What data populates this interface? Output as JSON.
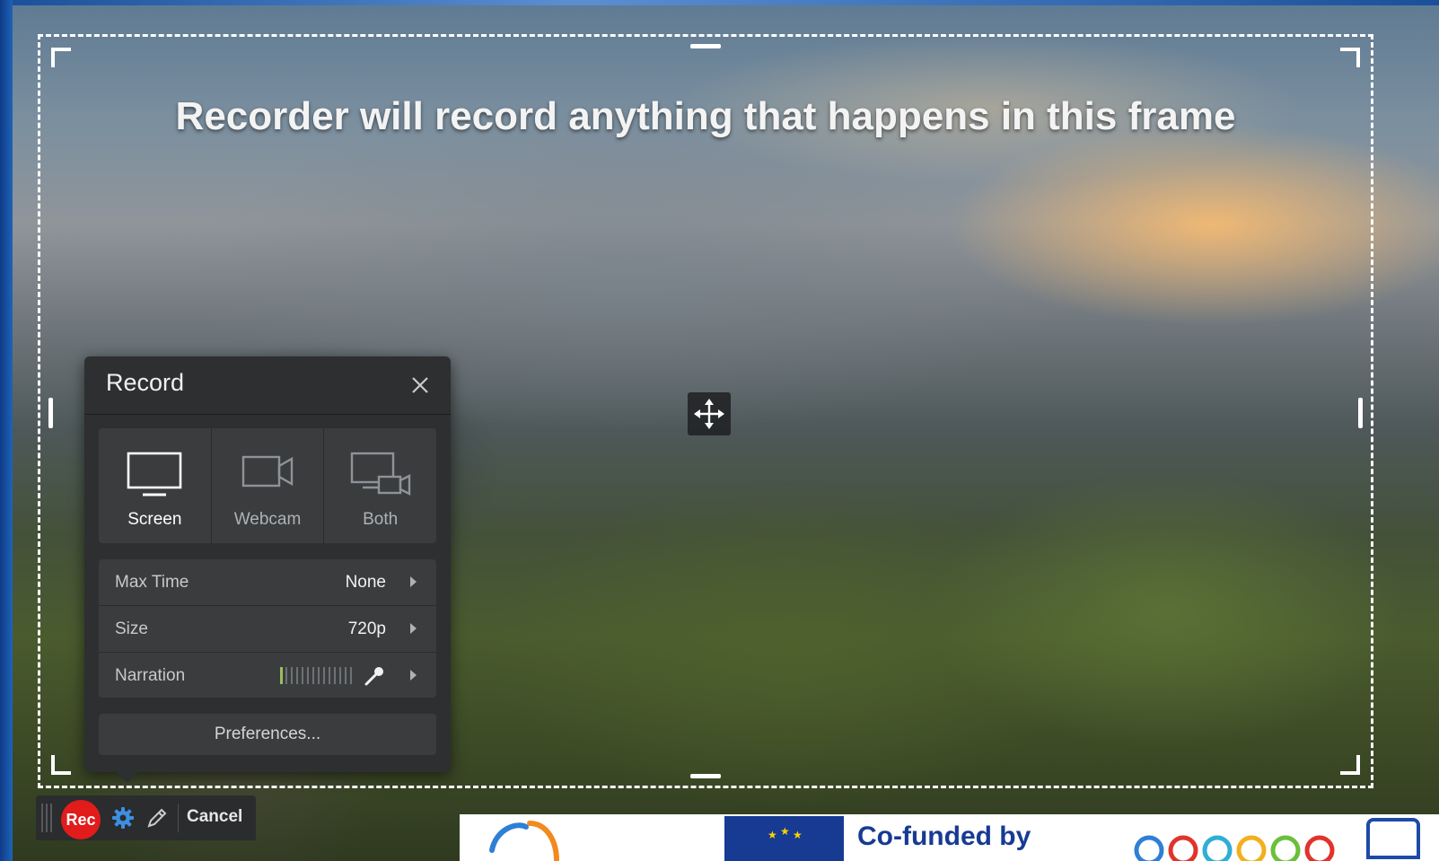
{
  "capture_frame": {
    "title": "Recorder will record anything that happens in this frame"
  },
  "record_panel": {
    "title": "Record",
    "modes": [
      {
        "label": "Screen",
        "icon": "monitor-icon",
        "selected": true
      },
      {
        "label": "Webcam",
        "icon": "webcam-icon",
        "selected": false
      },
      {
        "label": "Both",
        "icon": "screen-webcam-icon",
        "selected": false
      }
    ],
    "settings": {
      "max_time": {
        "label": "Max Time",
        "value": "None"
      },
      "size": {
        "label": "Size",
        "value": "720p"
      },
      "narration": {
        "label": "Narration",
        "icon": "microphone-icon"
      }
    },
    "preferences_label": "Preferences..."
  },
  "toolbar": {
    "rec_label": "Rec",
    "cancel_label": "Cancel",
    "rec_color": "#e21b1b",
    "accent_color": "#3d8fe0"
  },
  "footer_banner": {
    "cofunded_text": "Co-funded by",
    "eu_blue": "#173a93"
  }
}
